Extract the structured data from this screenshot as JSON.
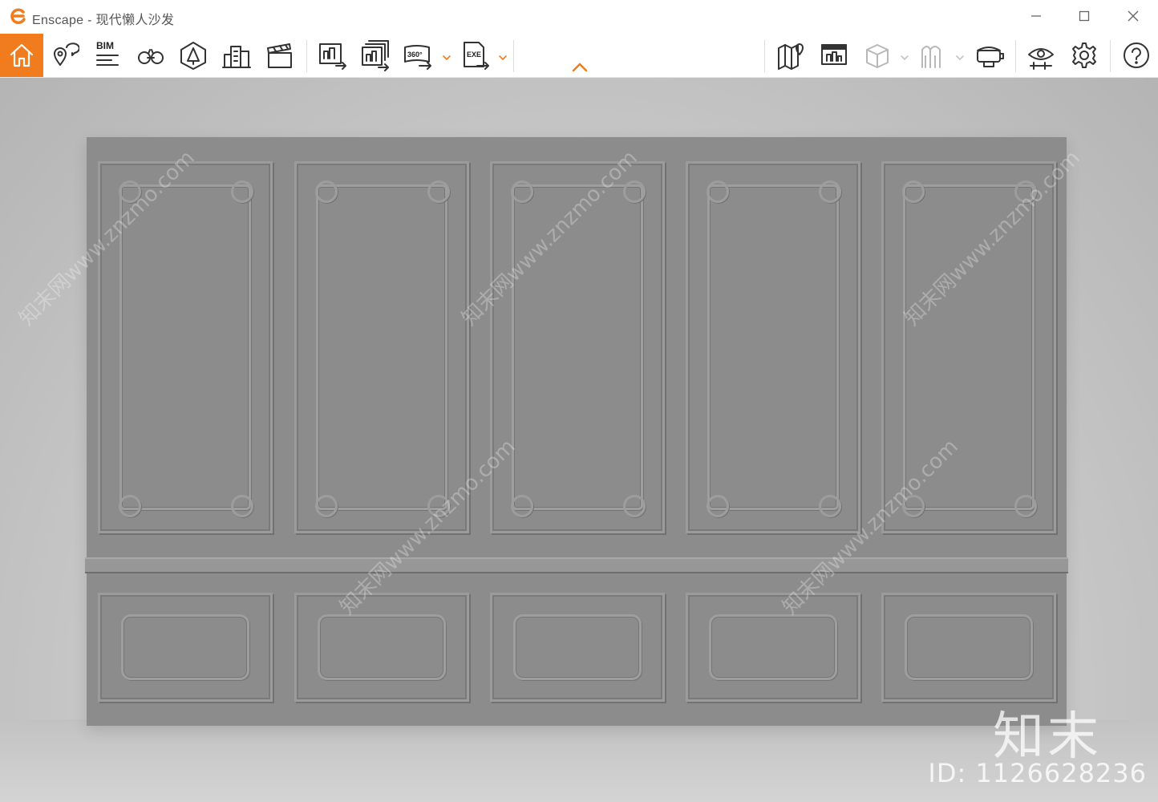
{
  "window": {
    "title": "Enscape - 现代懒人沙发",
    "controls": {
      "minimize": "minimize-icon",
      "maximize": "maximize-icon",
      "close": "close-icon"
    }
  },
  "toolbar": {
    "accent_color": "#f07c1e",
    "bim_label": "BIM",
    "panorama_label": "360°",
    "exe_label": "EXE",
    "left_group": [
      {
        "name": "home",
        "icon": "home-icon",
        "active": true
      },
      {
        "name": "views",
        "icon": "location-pin-icon"
      },
      {
        "name": "bim",
        "icon": "bim-list-icon"
      },
      {
        "name": "walk-mode",
        "icon": "binoculars-icon"
      },
      {
        "name": "asset-library",
        "icon": "asset-library-icon"
      },
      {
        "name": "buildings",
        "icon": "buildings-icon"
      },
      {
        "name": "video-editor",
        "icon": "clapperboard-icon"
      }
    ],
    "export_group": [
      {
        "name": "screenshot",
        "icon": "screenshot-export-icon"
      },
      {
        "name": "batch-render",
        "icon": "batch-render-icon"
      },
      {
        "name": "panorama",
        "icon": "panorama-360-icon",
        "dropdown": true
      },
      {
        "name": "standalone",
        "icon": "exe-export-icon",
        "dropdown": true
      }
    ],
    "collapse": "chevron-up-icon",
    "right_group": [
      {
        "name": "map",
        "icon": "map-pin-icon"
      },
      {
        "name": "render-settings",
        "icon": "render-window-icon"
      },
      {
        "name": "cube",
        "icon": "cube-icon",
        "dropdown": true,
        "disabled": true
      },
      {
        "name": "people",
        "icon": "people-icon",
        "dropdown": true,
        "disabled": true
      },
      {
        "name": "vr-headset",
        "icon": "vr-headset-icon"
      },
      {
        "name": "visual-settings",
        "icon": "eye-settings-icon"
      },
      {
        "name": "settings",
        "icon": "gear-icon"
      },
      {
        "name": "help",
        "icon": "help-icon"
      }
    ]
  },
  "viewport": {
    "watermark_brand": "知末",
    "watermark_id": "ID: 1126628236",
    "watermark_text": "知末网www.znzmo.com"
  }
}
